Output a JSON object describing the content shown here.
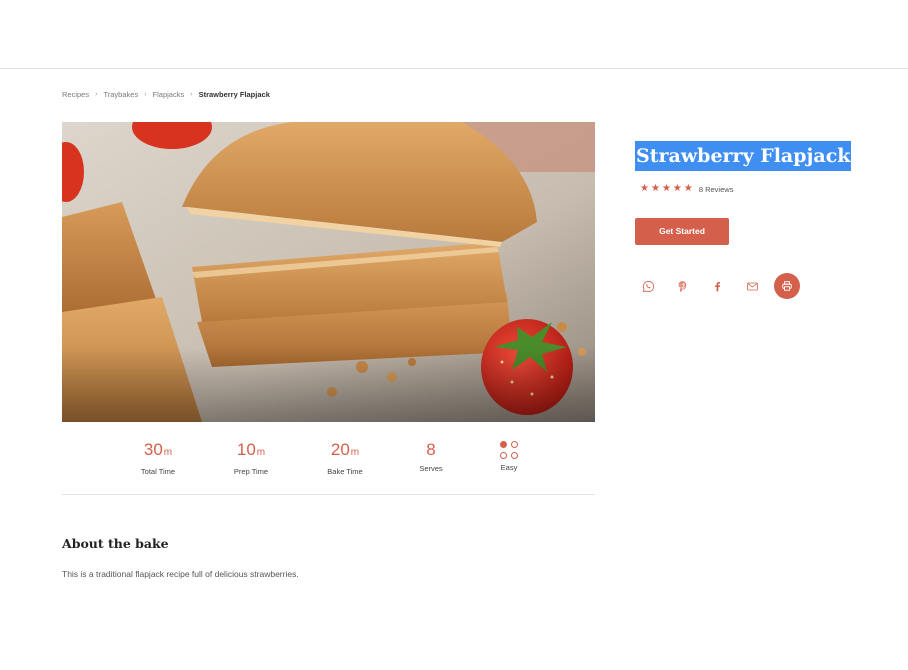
{
  "breadcrumb": {
    "items": [
      "Recipes",
      "Traybakes",
      "Flapjacks"
    ],
    "current": "Strawberry Flapjack"
  },
  "hero": {
    "alt_icon": "hero-photo"
  },
  "stats": [
    {
      "value": "30",
      "unit": "m",
      "label": "Total Time"
    },
    {
      "value": "10",
      "unit": "m",
      "label": "Prep Time"
    },
    {
      "value": "20",
      "unit": "m",
      "label": "Bake Time"
    },
    {
      "value": "8",
      "unit": "",
      "label": "Serves"
    },
    {
      "icon": "difficulty-icon",
      "label": "Easy"
    }
  ],
  "about": {
    "title": "About the bake",
    "text": "This is a traditional flapjack recipe full of delicious strawberries."
  },
  "recipe": {
    "title": "Strawberry Flapjack",
    "rating": 5,
    "reviews": "8 Reviews",
    "cta": "Get Started"
  },
  "share": {
    "icons": [
      "whatsapp-icon",
      "pinterest-icon",
      "facebook-icon",
      "email-icon",
      "print-icon"
    ]
  },
  "colors": {
    "accent": "#d4604b",
    "selection": "#3f8ff2",
    "divider": "#e3e3e3"
  }
}
